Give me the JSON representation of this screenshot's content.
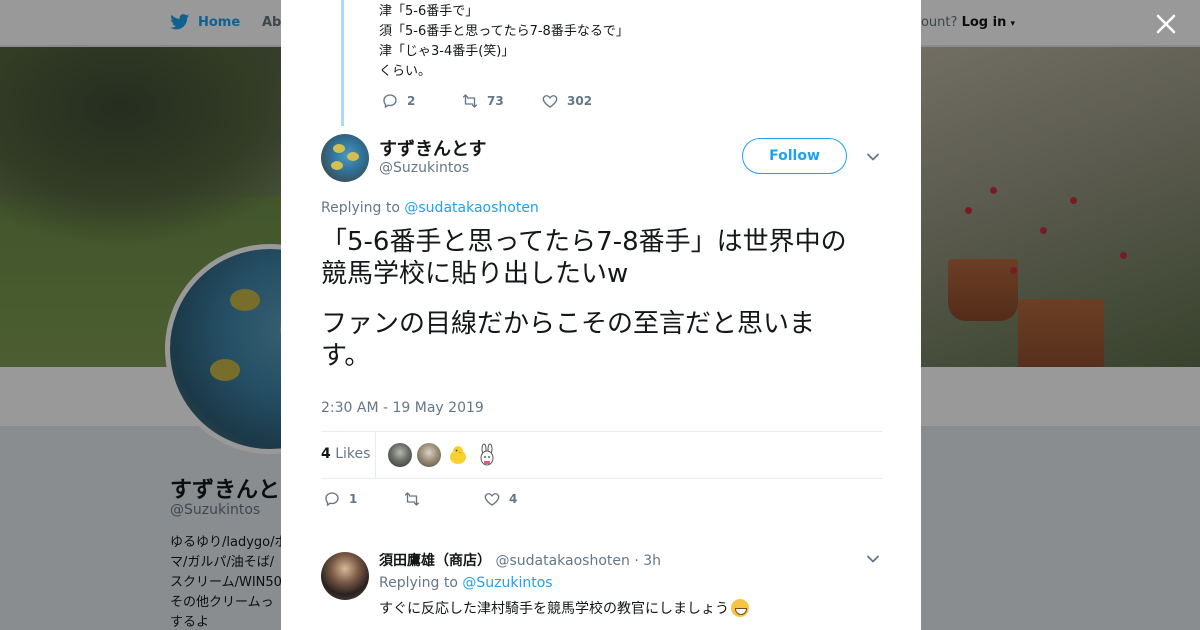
{
  "topbar": {
    "home_label": "Home",
    "about_label": "Abo",
    "account_text": "ccount?",
    "login_label": "Log in"
  },
  "profile": {
    "name": "すずきんとす",
    "handle": "@Suzukintos",
    "bio_lines": [
      "ゆるゆり/ladygo/ポ",
      "マ/ガルパ/油そば/",
      "スクリーム/WIN50",
      "その他クリームっ",
      "するよ"
    ]
  },
  "parent_tweet": {
    "lines": [
      "津「5-6番手で」",
      "須「5-6番手と思ってたら7-8番手なるで」",
      "津「じゃ3-4番手(笑)」",
      "くらい。"
    ],
    "replies": "2",
    "retweets": "73",
    "likes": "302"
  },
  "tweet": {
    "author_name": "すずきんとす",
    "author_handle": "@Suzukintos",
    "follow_label": "Follow",
    "replying_prefix": "Replying to",
    "replying_to": "@sudatakaoshoten",
    "text_lines_1": [
      "「5-6番手と思ってたら7-8番手」は世界中の",
      "競馬学校に貼り出したいw"
    ],
    "text_lines_2": [
      "ファンの目線だからこその至言だと思いま",
      "す。"
    ],
    "timestamp": "2:30 AM - 19 May 2019",
    "likes_count": "4",
    "likes_label": "Likes",
    "reply_count": "1",
    "retweet_count": "",
    "like_count": "4"
  },
  "reply": {
    "author_name": "須田鷹雄（商店）",
    "author_handle": "@sudatakaoshoten",
    "time": "· 3h",
    "replying_prefix": "Replying to",
    "replying_to": "@Suzukintos",
    "text": "すぐに反応した津村騎手を競馬学校の教官にしましょう"
  },
  "colors": {
    "accent": "#1da1f2",
    "muted": "#657786",
    "thread_line": "#a7dcf7"
  },
  "icons": [
    "twitter-bird-icon",
    "close-icon",
    "reply-icon",
    "retweet-icon",
    "heart-icon",
    "chevron-down-icon",
    "grinning-emoji-icon"
  ]
}
